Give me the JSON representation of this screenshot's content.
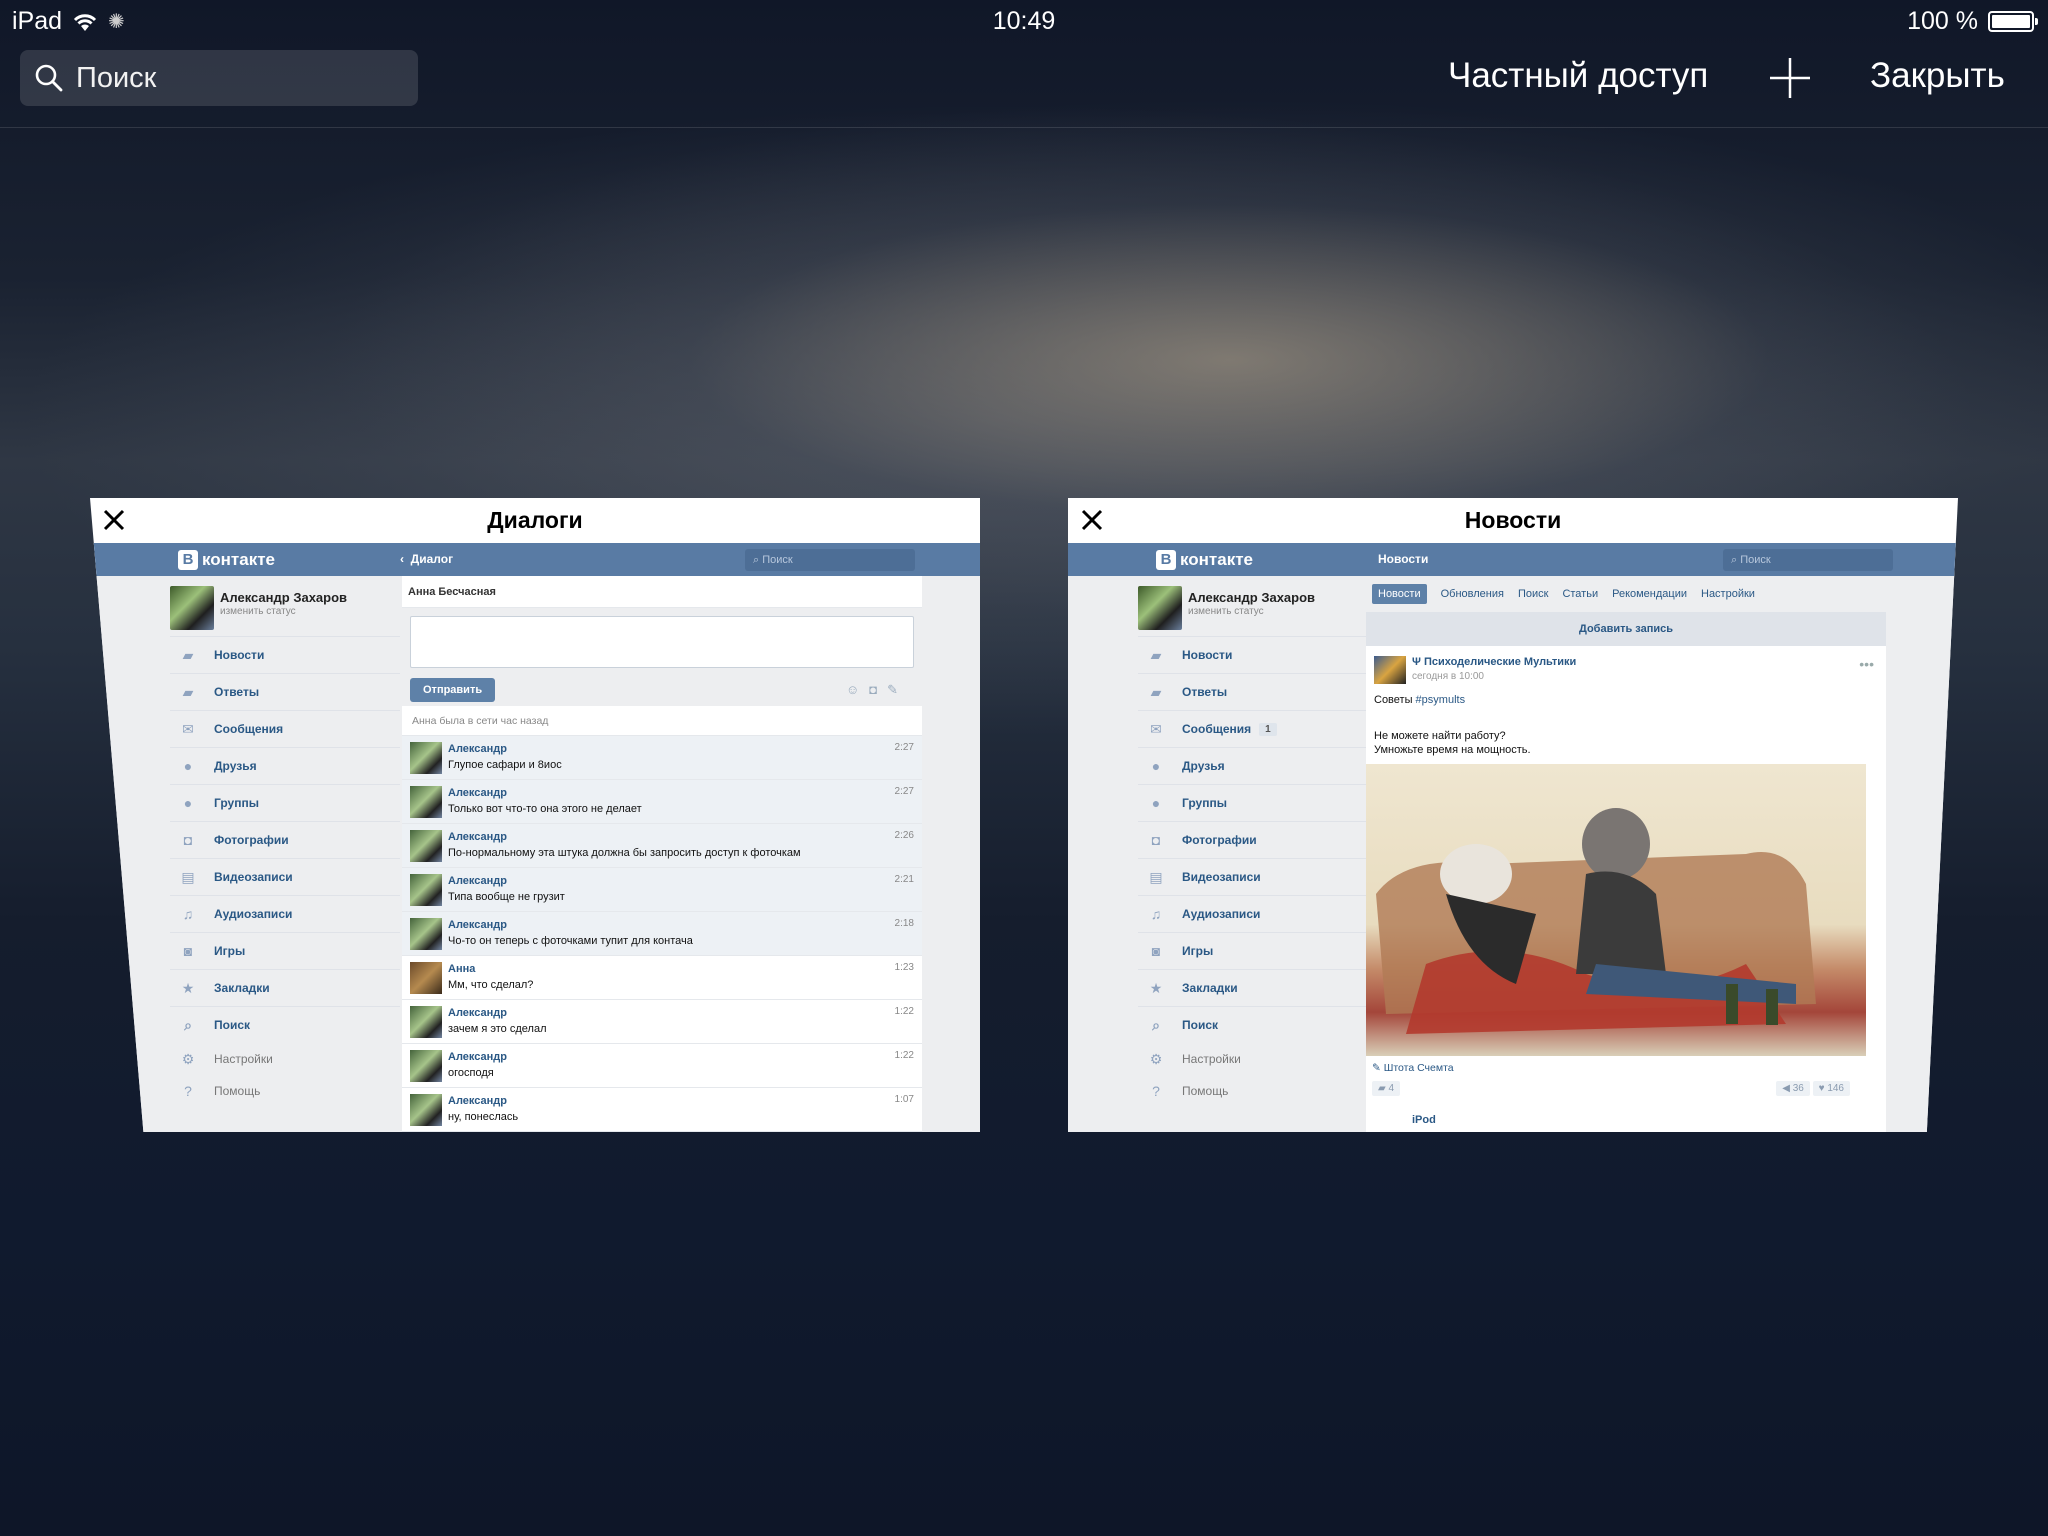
{
  "status_bar": {
    "device": "iPad",
    "time": "10:49",
    "battery": "100 %",
    "battery_level": 1.0
  },
  "toolbar": {
    "search_placeholder": "Поиск",
    "private_label": "Частный доступ",
    "close_label": "Закрыть"
  },
  "tabs": [
    {
      "title": "Диалоги",
      "vk": {
        "logo": "контакте",
        "header_title": "Диалог",
        "search_placeholder": "Поиск",
        "profile_name": "Александр Захаров",
        "profile_status": "изменить статус",
        "menu": [
          "Новости",
          "Ответы",
          "Сообщения",
          "Друзья",
          "Группы",
          "Фотографии",
          "Видеозаписи",
          "Аудиозаписи",
          "Игры",
          "Закладки",
          "Поиск"
        ],
        "menu_secondary": [
          "Настройки",
          "Помощь"
        ],
        "dialog_with": "Анна Бесчасная",
        "send_label": "Отправить",
        "online_status": "Анна была в сети час назад",
        "messages": [
          {
            "name": "Александр",
            "text": "Глупое сафари и 8иос",
            "time": "2:27"
          },
          {
            "name": "Александр",
            "text": "Только вот что-то она этого не делает",
            "time": "2:27"
          },
          {
            "name": "Александр",
            "text": "По-нормальному эта штука должна бы запросить доступ к фоточкам",
            "time": "2:26"
          },
          {
            "name": "Александр",
            "text": "Типа вообще не грузит",
            "time": "2:21"
          },
          {
            "name": "Александр",
            "text": "Чо-то он теперь с фоточками тупит для контача",
            "time": "2:18"
          },
          {
            "name": "Анна",
            "text": "Мм, что сделал?",
            "time": "1:23"
          },
          {
            "name": "Александр",
            "text": "зачем я это сделал",
            "time": "1:22"
          },
          {
            "name": "Александр",
            "text": "огосподя",
            "time": "1:22"
          },
          {
            "name": "Александр",
            "text": "ну, понеслась",
            "time": "1:07"
          }
        ]
      }
    },
    {
      "title": "Новости",
      "vk": {
        "logo": "контакте",
        "header_title": "Новости",
        "search_placeholder": "Поиск",
        "profile_name": "Александр Захаров",
        "profile_status": "изменить статус",
        "menu": [
          "Новости",
          "Ответы",
          "Сообщения",
          "Друзья",
          "Группы",
          "Фотографии",
          "Видеозаписи",
          "Аудиозаписи",
          "Игры",
          "Закладки",
          "Поиск"
        ],
        "messages_badge": "1",
        "menu_secondary": [
          "Настройки",
          "Помощь"
        ],
        "news_tabs": [
          "Новости",
          "Обновления",
          "Поиск",
          "Статьи",
          "Рекомендации",
          "Настройки"
        ],
        "add_post_label": "Добавить запись",
        "post": {
          "author": "Ψ Психоделические Мультики",
          "date": "сегодня в 10:00",
          "text_prefix": "Советы",
          "hashtag": "#psymults",
          "text_line1": "Не можете найти работу?",
          "text_line2": "Умножьте время на мощность.",
          "source": "Штота Счемта",
          "comments": "4",
          "reposts": "36",
          "likes": "146"
        },
        "next_post_author": "iPod"
      }
    }
  ]
}
